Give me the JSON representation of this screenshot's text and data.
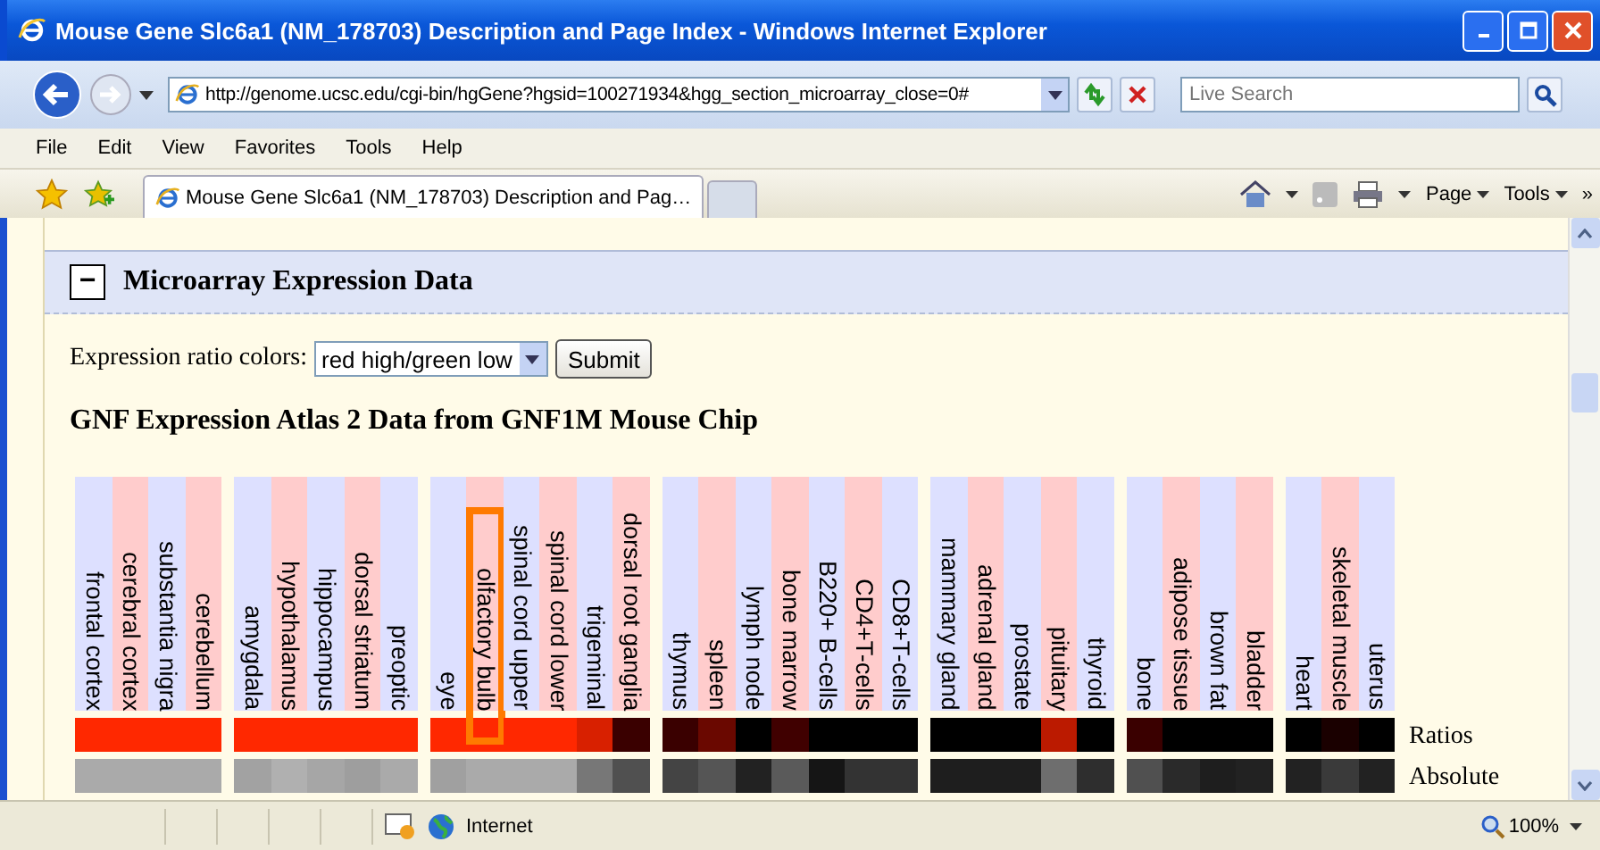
{
  "window": {
    "title": "Mouse Gene Slc6a1 (NM_178703) Description and Page Index - Windows Internet Explorer"
  },
  "navigation": {
    "url": "http://genome.ucsc.edu/cgi-bin/hgGene?hgsid=100271934&hgg_section_microarray_close=0#",
    "search_placeholder": "Live Search"
  },
  "menu": [
    "File",
    "Edit",
    "View",
    "Favorites",
    "Tools",
    "Help"
  ],
  "tabs": [
    {
      "label": "Mouse Gene Slc6a1 (NM_178703) Description and Pag…",
      "selected": true
    }
  ],
  "command_bar": {
    "items": [
      "Page",
      "Tools"
    ],
    "more": "»"
  },
  "section": {
    "toggle": "−",
    "title": "Microarray Expression Data"
  },
  "form": {
    "label": "Expression ratio colors:",
    "value": "red high/green low",
    "submit": "Submit"
  },
  "heading": "GNF Expression Atlas 2 Data from GNF1M Mouse Chip",
  "groups": [
    {
      "tissues": [
        {
          "name": "frontal cortex",
          "ratio": {
            "color": "#ff2800"
          },
          "absolute": {
            "color": "#aaaaaa"
          },
          "highlighted": false
        },
        {
          "name": "cerebral cortex",
          "ratio": {
            "color": "#ff2800"
          },
          "absolute": {
            "color": "#aaaaaa"
          },
          "highlighted": false
        },
        {
          "name": "substantia nigra",
          "ratio": {
            "color": "#ff2800"
          },
          "absolute": {
            "color": "#aaaaaa"
          },
          "highlighted": false
        },
        {
          "name": "cerebellum",
          "ratio": {
            "color": "#ff2800"
          },
          "absolute": {
            "color": "#aaaaaa"
          },
          "highlighted": false
        }
      ]
    },
    {
      "tissues": [
        {
          "name": "amygdala",
          "ratio": {
            "color": "#ff2800"
          },
          "absolute": {
            "color": "#a2a2a2"
          },
          "highlighted": false
        },
        {
          "name": "hypothalamus",
          "ratio": {
            "color": "#ff2800"
          },
          "absolute": {
            "color": "#b0b0b0"
          },
          "highlighted": false
        },
        {
          "name": "hippocampus",
          "ratio": {
            "color": "#ff2800"
          },
          "absolute": {
            "color": "#a6a6a6"
          },
          "highlighted": false
        },
        {
          "name": "dorsal striatum",
          "ratio": {
            "color": "#ff2800"
          },
          "absolute": {
            "color": "#9e9e9e"
          },
          "highlighted": false
        },
        {
          "name": "preoptic",
          "ratio": {
            "color": "#ff2800"
          },
          "absolute": {
            "color": "#aaaaaa"
          },
          "highlighted": false
        }
      ]
    },
    {
      "tissues": [
        {
          "name": "eye",
          "ratio": {
            "color": "#ff2800"
          },
          "absolute": {
            "color": "#a0a0a0"
          },
          "highlighted": false
        },
        {
          "name": "olfactory bulb",
          "ratio": {
            "color": "#ff2800"
          },
          "absolute": {
            "color": "#aaaaaa"
          },
          "highlighted": true
        },
        {
          "name": "spinal cord upper",
          "ratio": {
            "color": "#ff2800"
          },
          "absolute": {
            "color": "#aaaaaa"
          },
          "highlighted": false
        },
        {
          "name": "spinal cord lower",
          "ratio": {
            "color": "#ff2800"
          },
          "absolute": {
            "color": "#aaaaaa"
          },
          "highlighted": false
        },
        {
          "name": "trigeminal",
          "ratio": {
            "color": "#d82000"
          },
          "absolute": {
            "color": "#777777"
          },
          "highlighted": false
        },
        {
          "name": "dorsal root ganglia",
          "ratio": {
            "color": "#3a0000"
          },
          "absolute": {
            "color": "#505050"
          },
          "highlighted": false
        }
      ]
    },
    {
      "tissues": [
        {
          "name": "thymus",
          "ratio": {
            "color": "#3a0000"
          },
          "absolute": {
            "color": "#444444"
          },
          "highlighted": false
        },
        {
          "name": "spleen",
          "ratio": {
            "color": "#6a0800"
          },
          "absolute": {
            "color": "#555555"
          },
          "highlighted": false
        },
        {
          "name": "lymph node",
          "ratio": {
            "color": "#000000"
          },
          "absolute": {
            "color": "#222222"
          },
          "highlighted": false
        },
        {
          "name": "bone marrow",
          "ratio": {
            "color": "#400000"
          },
          "absolute": {
            "color": "#5a5a5a"
          },
          "highlighted": false
        },
        {
          "name": "B220+ B-cells",
          "ratio": {
            "color": "#000000"
          },
          "absolute": {
            "color": "#151515"
          },
          "highlighted": false
        },
        {
          "name": "CD4+T-cells",
          "ratio": {
            "color": "#000000"
          },
          "absolute": {
            "color": "#333333"
          },
          "highlighted": false
        },
        {
          "name": "CD8+T-cells",
          "ratio": {
            "color": "#000000"
          },
          "absolute": {
            "color": "#333333"
          },
          "highlighted": false
        }
      ]
    },
    {
      "tissues": [
        {
          "name": "mammary gland",
          "ratio": {
            "color": "#000000"
          },
          "absolute": {
            "color": "#1e1e1e"
          },
          "highlighted": false
        },
        {
          "name": "adrenal gland",
          "ratio": {
            "color": "#000000"
          },
          "absolute": {
            "color": "#1e1e1e"
          },
          "highlighted": false
        },
        {
          "name": "prostate",
          "ratio": {
            "color": "#000000"
          },
          "absolute": {
            "color": "#1e1e1e"
          },
          "highlighted": false
        },
        {
          "name": "pituitary",
          "ratio": {
            "color": "#bb1a00"
          },
          "absolute": {
            "color": "#6e6e6e"
          },
          "highlighted": false
        },
        {
          "name": "thyroid",
          "ratio": {
            "color": "#000000"
          },
          "absolute": {
            "color": "#2e2e2e"
          },
          "highlighted": false
        }
      ]
    },
    {
      "tissues": [
        {
          "name": "bone",
          "ratio": {
            "color": "#3a0000"
          },
          "absolute": {
            "color": "#505050"
          },
          "highlighted": false
        },
        {
          "name": "adipose tissue",
          "ratio": {
            "color": "#000000"
          },
          "absolute": {
            "color": "#2a2a2a"
          },
          "highlighted": false
        },
        {
          "name": "brown fat",
          "ratio": {
            "color": "#000000"
          },
          "absolute": {
            "color": "#1e1e1e"
          },
          "highlighted": false
        },
        {
          "name": "bladder",
          "ratio": {
            "color": "#000000"
          },
          "absolute": {
            "color": "#222222"
          },
          "highlighted": false
        }
      ]
    },
    {
      "tissues": [
        {
          "name": "heart",
          "ratio": {
            "color": "#000000"
          },
          "absolute": {
            "color": "#222222"
          },
          "highlighted": false
        },
        {
          "name": "skeletal muscle",
          "ratio": {
            "color": "#1a0000"
          },
          "absolute": {
            "color": "#3a3a3a"
          },
          "highlighted": false
        },
        {
          "name": "uterus",
          "ratio": {
            "color": "#000000"
          },
          "absolute": {
            "color": "#222222"
          },
          "highlighted": false
        }
      ]
    }
  ],
  "row_labels": [
    "Ratios",
    "Absolute"
  ],
  "status_bar": {
    "zone": "Internet",
    "zoom": "100%"
  }
}
